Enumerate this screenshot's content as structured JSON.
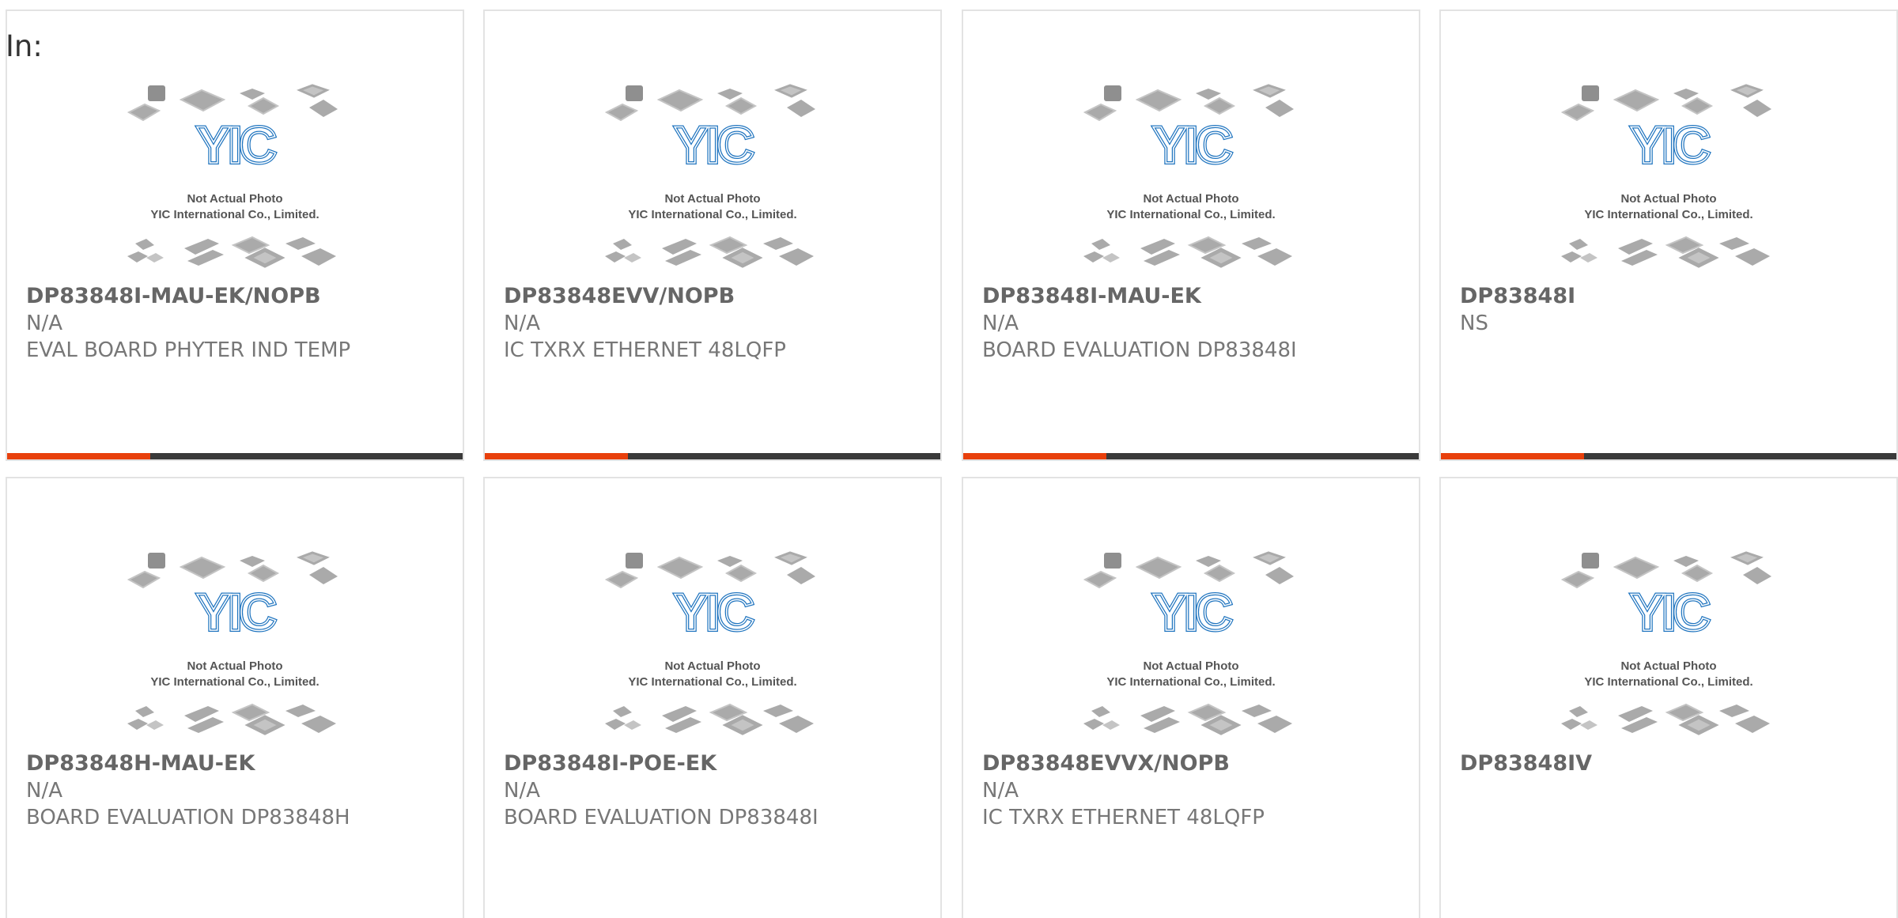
{
  "page": {
    "label": "In:",
    "placeholder_image": {
      "caption_line1": "Not Actual Photo",
      "caption_line2": "YIC International Co., Limited.",
      "logo_text": "YIC",
      "icon": "ic-chip-package-icons"
    }
  },
  "colors": {
    "accent": "#e8400c",
    "bar": "#3a3a3a",
    "text_bold": "#666666",
    "text": "#777777",
    "logo": "#1f74bf",
    "border": "#e3e3e3"
  },
  "products": [
    {
      "part_number": "DP83848I-MAU-EK/NOPB",
      "manufacturer": "N/A",
      "description": "EVAL BOARD PHYTER IND TEMP",
      "accent_fraction": 0.315
    },
    {
      "part_number": "DP83848EVV/NOPB",
      "manufacturer": "N/A",
      "description": "IC TXRX ETHERNET 48LQFP",
      "accent_fraction": 0.315
    },
    {
      "part_number": "DP83848I-MAU-EK",
      "manufacturer": "N/A",
      "description": "BOARD EVALUATION DP83848I",
      "accent_fraction": 0.315
    },
    {
      "part_number": "DP83848I",
      "manufacturer": "NS",
      "description": "",
      "accent_fraction": 0.315
    },
    {
      "part_number": "DP83848H-MAU-EK",
      "manufacturer": "N/A",
      "description": "BOARD EVALUATION DP83848H"
    },
    {
      "part_number": "DP83848I-POE-EK",
      "manufacturer": "N/A",
      "description": "BOARD EVALUATION DP83848I"
    },
    {
      "part_number": "DP83848EVVX/NOPB",
      "manufacturer": "N/A",
      "description": "IC TXRX ETHERNET 48LQFP"
    },
    {
      "part_number": "DP83848IV",
      "manufacturer": "",
      "description": ""
    }
  ]
}
